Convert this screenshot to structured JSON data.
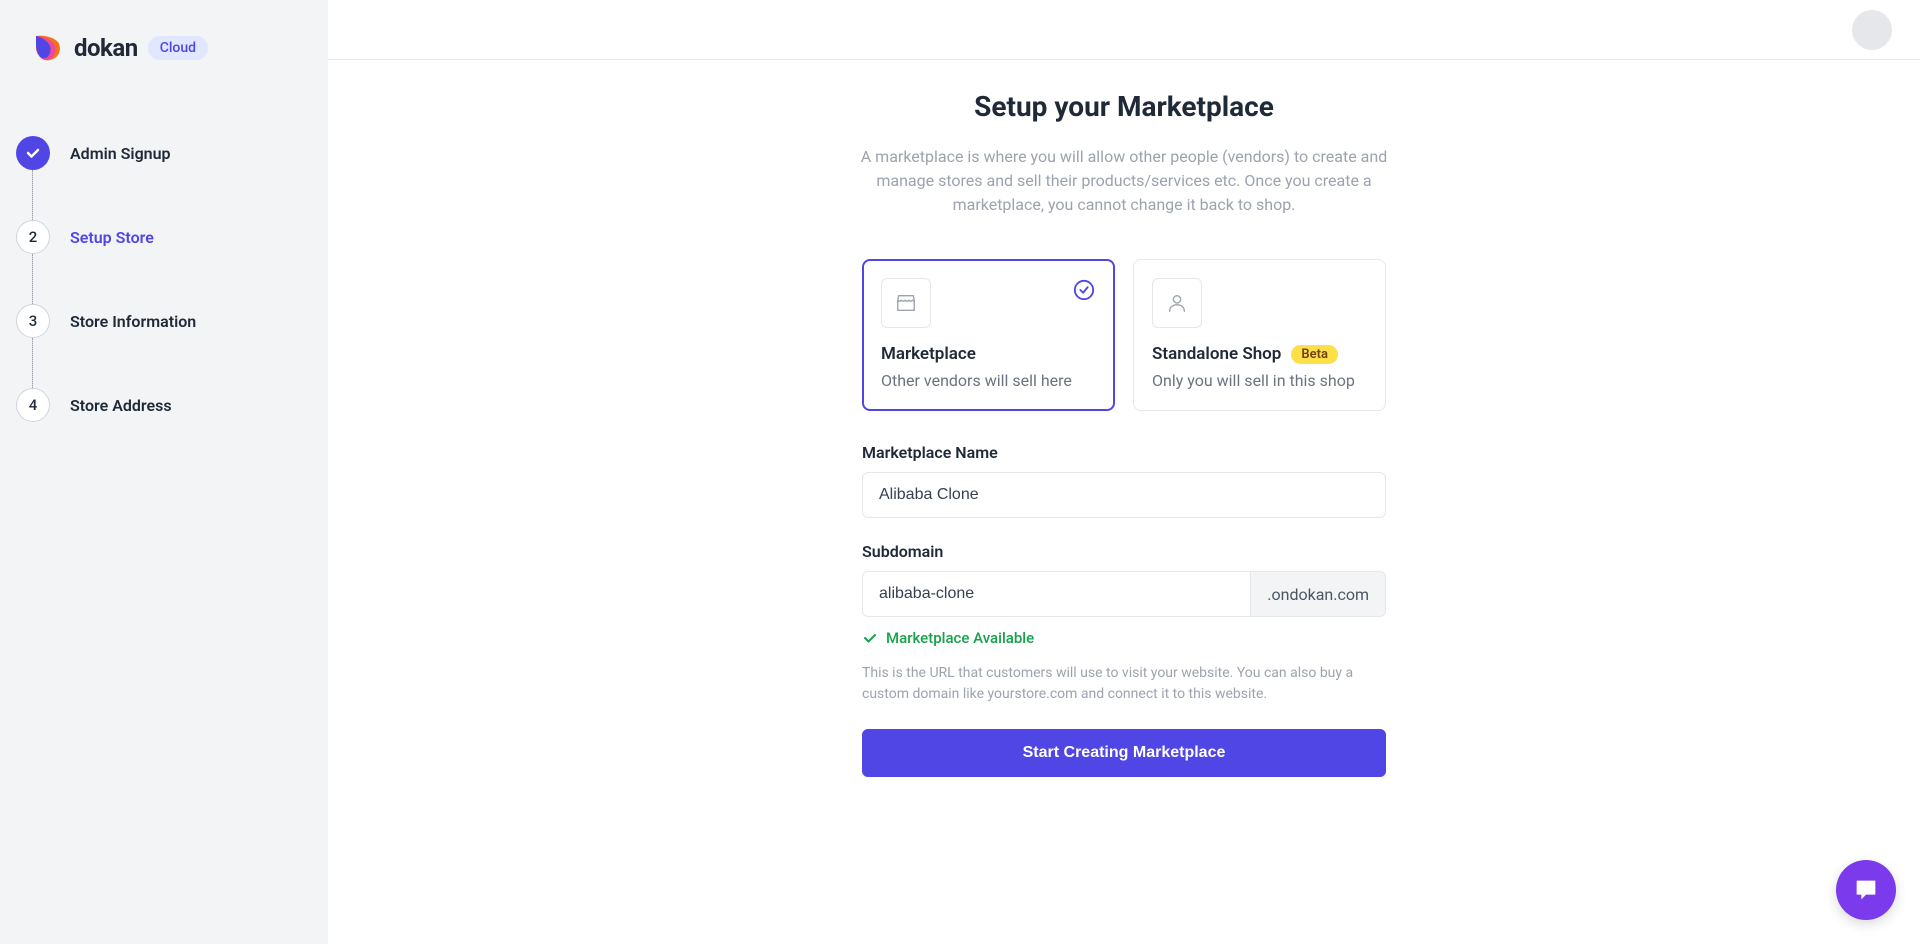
{
  "brand": {
    "name": "dokan",
    "badge": "Cloud"
  },
  "steps": [
    {
      "num": "1",
      "label": "Admin Signup",
      "state": "completed"
    },
    {
      "num": "2",
      "label": "Setup Store",
      "state": "current"
    },
    {
      "num": "3",
      "label": "Store Information",
      "state": "upcoming"
    },
    {
      "num": "4",
      "label": "Store Address",
      "state": "upcoming"
    }
  ],
  "page": {
    "title": "Setup your Marketplace",
    "description": "A marketplace is where you will allow other people (vendors) to create and manage stores and sell their products/services etc. Once you create a marketplace, you cannot change it back to shop."
  },
  "cards": {
    "marketplace": {
      "title": "Marketplace",
      "desc": "Other vendors will sell here"
    },
    "standalone": {
      "title": "Standalone Shop",
      "badge": "Beta",
      "desc": "Only you will sell in this shop"
    }
  },
  "form": {
    "name_label": "Marketplace Name",
    "name_value": "Alibaba Clone",
    "subdomain_label": "Subdomain",
    "subdomain_value": "alibaba-clone",
    "subdomain_suffix": ".ondokan.com",
    "availability_text": "Marketplace Available",
    "help_text": "This is the URL that customers will use to visit your website. You can also buy a custom domain like yourstore.com and connect it to this website.",
    "submit_label": "Start Creating Marketplace"
  }
}
